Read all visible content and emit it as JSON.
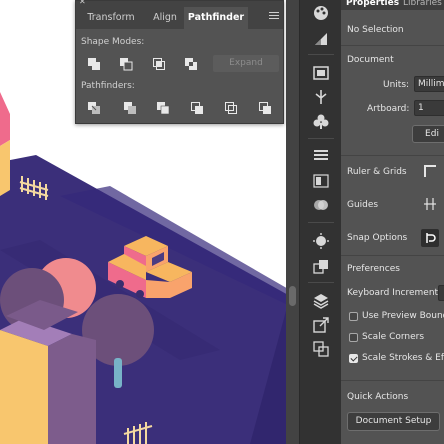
{
  "panel": {
    "tabs": [
      "Transform",
      "Align",
      "Pathfinder"
    ],
    "active_tab": "Pathfinder",
    "shape_modes_label": "Shape Modes:",
    "pathfinders_label": "Pathfinders:",
    "expand_label": "Expand",
    "shape_mode_icons": [
      "unite-icon",
      "minus-front-icon",
      "intersect-icon",
      "exclude-icon"
    ],
    "pathfinder_icons": [
      "divide-icon",
      "trim-icon",
      "merge-icon",
      "crop-icon",
      "outline-icon",
      "minus-back-icon"
    ]
  },
  "properties": {
    "tabs": [
      "Properties",
      "Libraries"
    ],
    "selection": "No Selection",
    "document_heading": "Document",
    "units_label": "Units:",
    "units_value": "Millim",
    "artboard_label": "Artboard:",
    "artboard_value": "1",
    "edit_artboards_label": "Edi",
    "ruler_grids_label": "Ruler & Grids",
    "guides_label": "Guides",
    "snap_options_label": "Snap Options",
    "preferences_heading": "Preferences",
    "keyboard_increment_label": "Keyboard Increment:",
    "use_preview_bounds": "Use Preview Bounds",
    "use_preview_bounds_checked": false,
    "scale_corners": "Scale Corners",
    "scale_corners_checked": false,
    "scale_strokes": "Scale Strokes & Effects",
    "scale_strokes_checked": true,
    "quick_actions_heading": "Quick Actions",
    "document_setup_label": "Document Setup"
  },
  "toolbar": {
    "icons": [
      "color-palette-icon",
      "gradient-icon",
      "artboards-icon",
      "puppet-warp-icon",
      "symbols-icon",
      "stroke-icon",
      "gradient-panel-icon",
      "transparency-icon",
      "appearance-icon",
      "graphic-styles-icon",
      "layers-icon",
      "export-icon",
      "asset-export-icon"
    ]
  },
  "colors": {
    "ui_panel": "#535353",
    "ui_dark": "#323232",
    "ground": "#3b2f7a",
    "ground_dark": "#2b2266",
    "car": "#f7b65f",
    "car_side": "#ef6b8c",
    "building": "#f8c66e",
    "building_side": "#7d5c8c",
    "tree": "#6c4f7a",
    "tree_light": "#f08b8e",
    "trunk": "#78b3c8"
  }
}
